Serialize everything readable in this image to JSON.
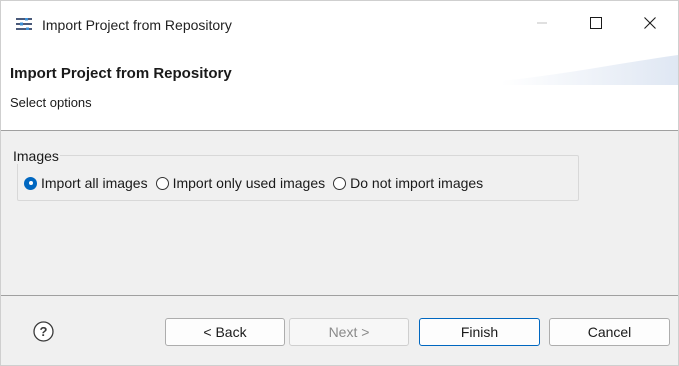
{
  "window": {
    "title": "Import Project from Repository"
  },
  "header": {
    "title": "Import Project from Repository",
    "subtitle": "Select options"
  },
  "images_group": {
    "label": "Images",
    "options": [
      {
        "label": "Import all images",
        "selected": true
      },
      {
        "label": "Import only used images",
        "selected": false
      },
      {
        "label": "Do not import images",
        "selected": false
      }
    ]
  },
  "footer": {
    "back_label": "< Back",
    "next_label": "Next >",
    "finish_label": "Finish",
    "cancel_label": "Cancel"
  },
  "colors": {
    "accent": "#0067c0",
    "background": "#f0f0f0"
  },
  "icons": {
    "app": "settings-sliders-icon",
    "minimize": "minimize-icon",
    "maximize": "maximize-icon",
    "close": "close-icon",
    "help": "help-icon"
  }
}
